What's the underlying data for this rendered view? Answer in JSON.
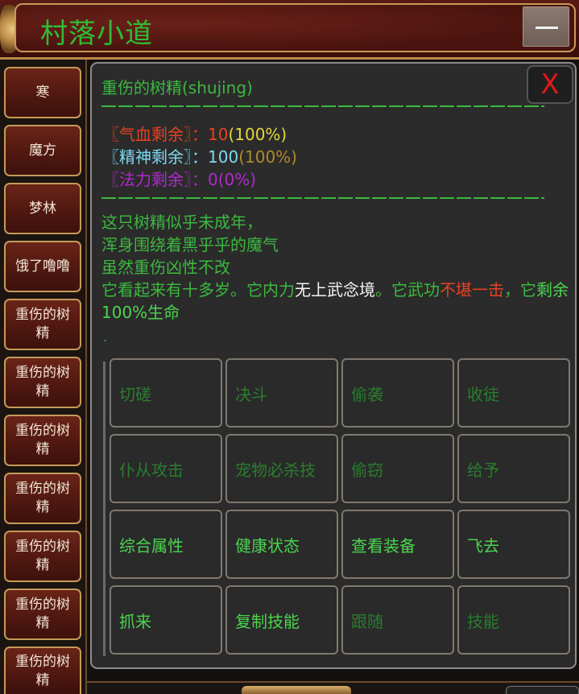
{
  "header": {
    "title": "村落小道",
    "minimize_icon": "minus-icon"
  },
  "sidebar": {
    "items": [
      {
        "label": "寒"
      },
      {
        "label": "魔方"
      },
      {
        "label": "梦林"
      },
      {
        "label": "饿了噜噜"
      },
      {
        "label": "重伤的树精"
      },
      {
        "label": "重伤的树精"
      },
      {
        "label": "重伤的树精"
      },
      {
        "label": "重伤的树精"
      },
      {
        "label": "重伤的树精"
      },
      {
        "label": "重伤的树精"
      },
      {
        "label": "重伤的树精"
      }
    ]
  },
  "panel": {
    "title": "重伤的树精(shujing)",
    "close_label": "X",
    "separator": "——————————————————————————",
    "stats": [
      {
        "label": "〖气血剩余〗：",
        "value": "10",
        "percent": "(100%)",
        "label_color": "#e64321",
        "value_color": "#e64321",
        "percent_color": "#e4d83c"
      },
      {
        "label": "〖精神剩余〗：",
        "value": "100",
        "percent": "(100%)",
        "label_color": "#7fd9f3",
        "value_color": "#7fd9f3",
        "percent_color": "#b08a2a"
      },
      {
        "label": "〖法力剩余〗：",
        "value": "0",
        "percent": "(0%)",
        "label_color": "#b02ad0",
        "value_color": "#b02ad0",
        "percent_color": "#b02ad0"
      }
    ],
    "desc": {
      "line1": "这只树精似乎未成年，",
      "line2": "浑身围绕着黑乎乎的魔气",
      "line3": "虽然重伤凶性不改",
      "l4_a": "它看起来有十多岁。它内力",
      "l4_b": "无上武念境",
      "l4_c": "。它武功",
      "l4_d": "不堪一击",
      "l4_e": "，它",
      "l4_f": "剩余100%生命",
      "dot": "."
    },
    "actions": [
      {
        "label": "切磋",
        "enabled": false
      },
      {
        "label": "决斗",
        "enabled": false
      },
      {
        "label": "偷袭",
        "enabled": false
      },
      {
        "label": "收徒",
        "enabled": false
      },
      {
        "label": "仆从攻击",
        "enabled": false
      },
      {
        "label": "宠物必杀技",
        "enabled": false
      },
      {
        "label": "偷窃",
        "enabled": false
      },
      {
        "label": "给予",
        "enabled": false
      },
      {
        "label": "综合属性",
        "enabled": true
      },
      {
        "label": "健康状态",
        "enabled": true
      },
      {
        "label": "查看装备",
        "enabled": true
      },
      {
        "label": "飞去",
        "enabled": true
      },
      {
        "label": "抓来",
        "enabled": true
      },
      {
        "label": "复制技能",
        "enabled": true
      },
      {
        "label": "跟随",
        "enabled": false
      },
      {
        "label": "技能",
        "enabled": false
      }
    ]
  },
  "colors": {
    "title_green": "#2fbd35",
    "text_green": "#3cb83f",
    "highlight_white": "#f3f3f3",
    "highlight_red": "#e64321"
  }
}
